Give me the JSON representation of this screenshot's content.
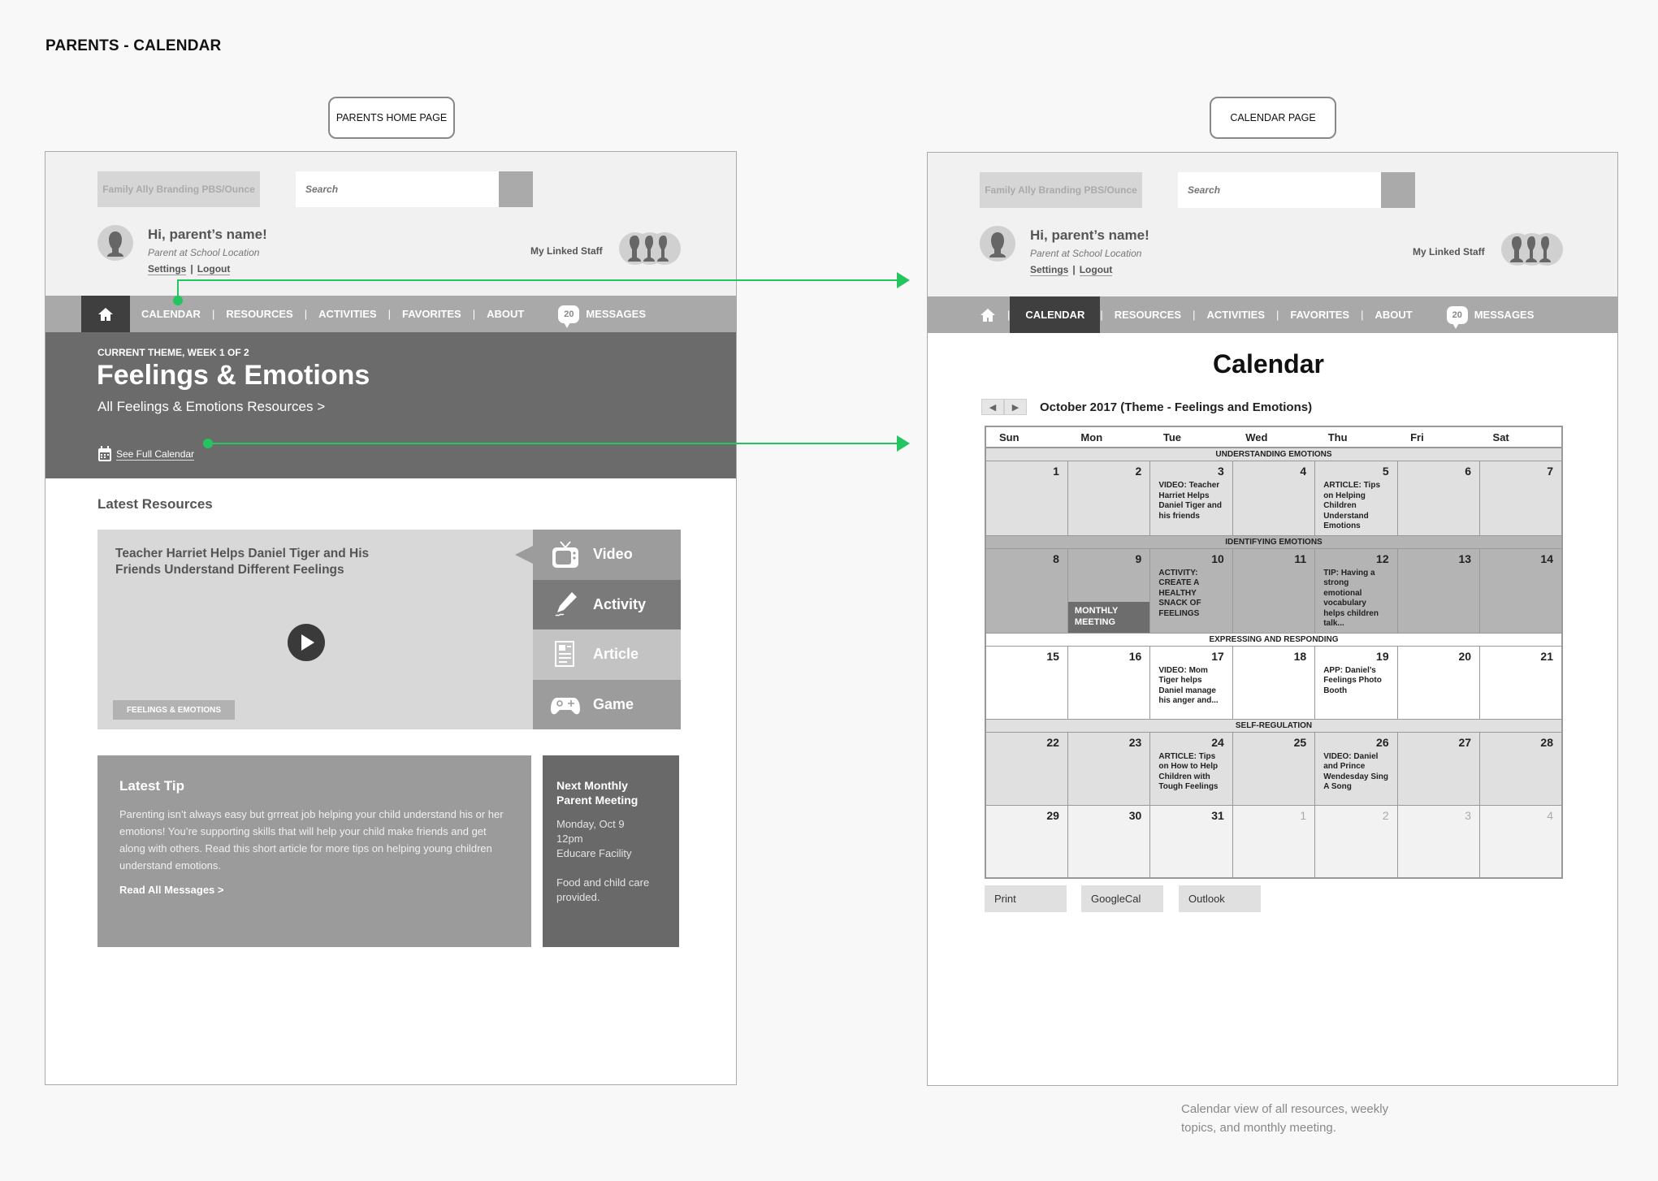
{
  "document": {
    "title": "PARENTS - CALENDAR",
    "caption": "Calendar view of all resources, weekly topics, and monthly meeting."
  },
  "frames": {
    "home_label": "PARENTS HOME PAGE",
    "calendar_label": "CALENDAR PAGE"
  },
  "header": {
    "brand": "Family Ally Branding PBS/Ounce",
    "search_placeholder": "Search",
    "greeting": "Hi, parent’s name!",
    "role": "Parent at School Location",
    "settings": "Settings",
    "separator": "|",
    "logout": "Logout",
    "linked_staff": "My Linked Staff"
  },
  "nav": {
    "home_icon": "home-icon",
    "items": [
      "CALENDAR",
      "RESOURCES",
      "ACTIVITIES",
      "FAVORITES",
      "ABOUT"
    ],
    "separator": "|",
    "messages_count": "20",
    "messages_label": "MESSAGES"
  },
  "home": {
    "hero": {
      "eyebrow": "CURRENT THEME, WEEK 1 OF 2",
      "title": "Feelings & Emotions",
      "resources_link": "All Feelings & Emotions Resources  >",
      "full_calendar": "See Full Calendar"
    },
    "latest_resources": "Latest Resources",
    "resource": {
      "title": "Teacher Harriet Helps Daniel Tiger and His Friends Understand Different Feelings",
      "tag": "FEELINGS & EMOTIONS",
      "types": [
        {
          "label": "Video",
          "icon": "tv-icon"
        },
        {
          "label": "Activity",
          "icon": "crayon-icon"
        },
        {
          "label": "Article",
          "icon": "article-icon"
        },
        {
          "label": "Game",
          "icon": "gamepad-icon"
        }
      ]
    },
    "tip": {
      "heading": "Latest Tip",
      "body": "Parenting isn’t always easy but grrreat job helping your child understand his or her emotions! You’re supporting skills that will help your child make friends and get along with others. Read this short article for more tips on helping young children understand emotions.",
      "link": "Read All Messages >"
    },
    "meeting": {
      "heading": "Next Monthly Parent Meeting",
      "date": "Monday, Oct 9",
      "time": "12pm",
      "location": "Educare Facility",
      "note": "Food and child care provided."
    }
  },
  "calendar": {
    "title": "Calendar",
    "prev": "◀",
    "next": "▶",
    "month_label": "October 2017 (Theme - Feelings and Emotions)",
    "days": [
      "Sun",
      "Mon",
      "Tue",
      "Wed",
      "Thu",
      "Fri",
      "Sat"
    ],
    "weeks": [
      {
        "topic": "UNDERSTANDING EMOTIONS",
        "cells": [
          {
            "n": "1",
            "ev": ""
          },
          {
            "n": "2",
            "ev": ""
          },
          {
            "n": "3",
            "ev": "VIDEO: Teacher Harriet Helps Daniel Tiger and his friends"
          },
          {
            "n": "4",
            "ev": ""
          },
          {
            "n": "5",
            "ev": "ARTICLE: Tips on Helping Children Understand Emotions"
          },
          {
            "n": "6",
            "ev": ""
          },
          {
            "n": "7",
            "ev": ""
          }
        ]
      },
      {
        "topic": "IDENTIFYING EMOTIONS",
        "cells": [
          {
            "n": "8",
            "ev": ""
          },
          {
            "n": "9",
            "ev": "",
            "badge": "MONTHLY MEETING"
          },
          {
            "n": "10",
            "ev": "ACTIVITY: CREATE A HEALTHY SNACK OF FEELINGS"
          },
          {
            "n": "11",
            "ev": ""
          },
          {
            "n": "12",
            "ev": "TIP: Having a strong emotional vocabulary helps children talk..."
          },
          {
            "n": "13",
            "ev": ""
          },
          {
            "n": "14",
            "ev": ""
          }
        ]
      },
      {
        "topic": "EXPRESSING AND RESPONDING",
        "cells": [
          {
            "n": "15",
            "ev": ""
          },
          {
            "n": "16",
            "ev": ""
          },
          {
            "n": "17",
            "ev": "VIDEO: Mom Tiger helps Daniel manage his anger and..."
          },
          {
            "n": "18",
            "ev": ""
          },
          {
            "n": "19",
            "ev": "APP: Daniel’s Feelings Photo Booth"
          },
          {
            "n": "20",
            "ev": ""
          },
          {
            "n": "21",
            "ev": ""
          }
        ]
      },
      {
        "topic": "SELF-REGULATION",
        "cells": [
          {
            "n": "22",
            "ev": ""
          },
          {
            "n": "23",
            "ev": ""
          },
          {
            "n": "24",
            "ev": "ARTICLE: Tips on How to Help Children with Tough Feelings"
          },
          {
            "n": "25",
            "ev": ""
          },
          {
            "n": "26",
            "ev": "VIDEO: Daniel and Prince Wendesday Sing A Song"
          },
          {
            "n": "27",
            "ev": ""
          },
          {
            "n": "28",
            "ev": ""
          }
        ]
      },
      {
        "topic": "",
        "cells": [
          {
            "n": "29",
            "ev": ""
          },
          {
            "n": "30",
            "ev": ""
          },
          {
            "n": "31",
            "ev": ""
          },
          {
            "n": "1",
            "ev": "",
            "other": true
          },
          {
            "n": "2",
            "ev": "",
            "other": true
          },
          {
            "n": "3",
            "ev": "",
            "other": true
          },
          {
            "n": "4",
            "ev": "",
            "other": true
          }
        ]
      }
    ],
    "exports": [
      "Print",
      "GoogleCal",
      "Outlook"
    ]
  },
  "colors": {
    "connector": "#22c55e",
    "nav": "#a9a9a9",
    "nav_active": "#3f3f3f",
    "hero": "#6b6b6b"
  }
}
